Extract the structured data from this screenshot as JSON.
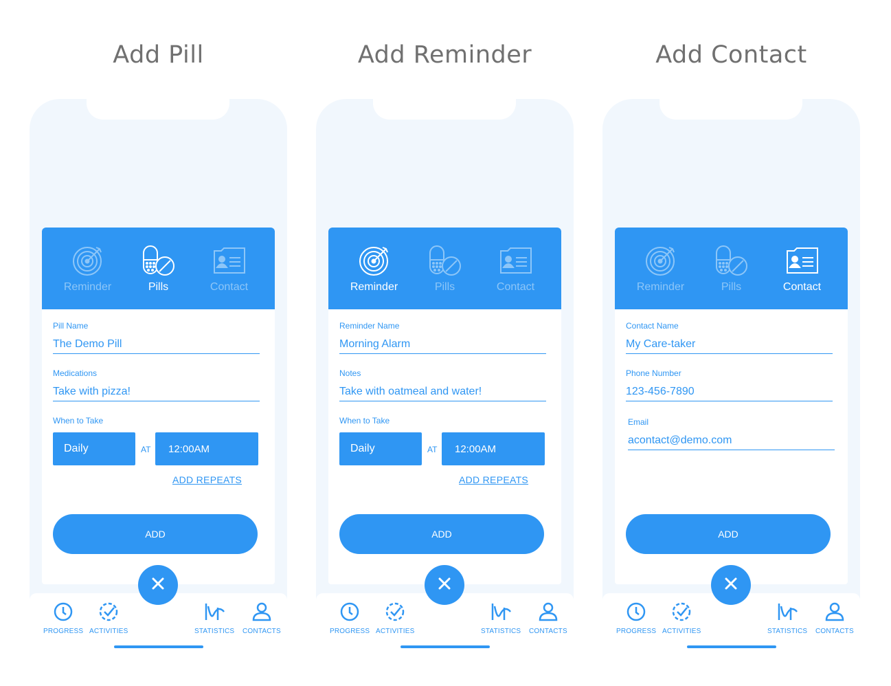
{
  "screens": [
    {
      "title": "Add Pill",
      "tabs": [
        {
          "label": "Reminder",
          "icon": "target-icon"
        },
        {
          "label": "Pills",
          "icon": "pills-icon"
        },
        {
          "label": "Contact",
          "icon": "contact-card-icon"
        }
      ],
      "active_tab": 1,
      "fields": [
        {
          "label": "Pill Name",
          "value": "The Demo Pill"
        },
        {
          "label": "Medications",
          "value": "Take with pizza!"
        }
      ],
      "when_label": "When to Take",
      "frequency": "Daily",
      "at_label": "AT",
      "time": "12:00AM",
      "repeats_link": "ADD REPEATS",
      "add_label": "ADD"
    },
    {
      "title": "Add Reminder",
      "tabs": [
        {
          "label": "Reminder",
          "icon": "target-icon"
        },
        {
          "label": "Pills",
          "icon": "pills-icon"
        },
        {
          "label": "Contact",
          "icon": "contact-card-icon"
        }
      ],
      "active_tab": 0,
      "fields": [
        {
          "label": "Reminder Name",
          "value": "Morning Alarm"
        },
        {
          "label": "Notes",
          "value": "Take with oatmeal and water!"
        }
      ],
      "when_label": "When to Take",
      "frequency": "Daily",
      "at_label": "AT",
      "time": "12:00AM",
      "repeats_link": "ADD REPEATS",
      "add_label": "ADD"
    },
    {
      "title": "Add Contact",
      "tabs": [
        {
          "label": "Reminder",
          "icon": "target-icon"
        },
        {
          "label": "Pills",
          "icon": "pills-icon"
        },
        {
          "label": "Contact",
          "icon": "contact-card-icon"
        }
      ],
      "active_tab": 2,
      "fields": [
        {
          "label": "Contact Name",
          "value": "My Care-taker"
        },
        {
          "label": "Phone Number",
          "value": "123-456-7890"
        },
        {
          "label": "Email",
          "value": "acontact@demo.com"
        }
      ],
      "add_label": "ADD"
    }
  ],
  "bottom_nav": [
    {
      "label": "PROGRESS",
      "icon": "clock-icon"
    },
    {
      "label": "ACTIVITIES",
      "icon": "activity-check-icon"
    },
    {
      "label": "STATISTICS",
      "icon": "statistics-wave-icon"
    },
    {
      "label": "CONTACTS",
      "icon": "person-icon"
    }
  ],
  "colors": {
    "accent": "#2f96f3",
    "inactive_tab": "#8dc6f8",
    "phone_bg": "#f1f7fd",
    "title": "#707070"
  }
}
